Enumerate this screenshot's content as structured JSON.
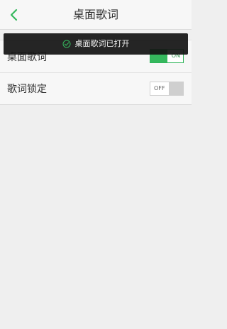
{
  "header": {
    "title": "桌面歌词",
    "back_icon": "chevron-left-icon"
  },
  "settings": {
    "items": [
      {
        "label": "桌面歌词",
        "toggle_label": "ON",
        "state": "on"
      },
      {
        "label": "歌词锁定",
        "toggle_label": "OFF",
        "state": "off"
      }
    ]
  },
  "toast": {
    "icon": "check-circle-icon",
    "message": "桌面歌词已打开"
  },
  "colors": {
    "accent": "#35b85d",
    "background": "#efefef",
    "toast_bg": "#141414"
  }
}
